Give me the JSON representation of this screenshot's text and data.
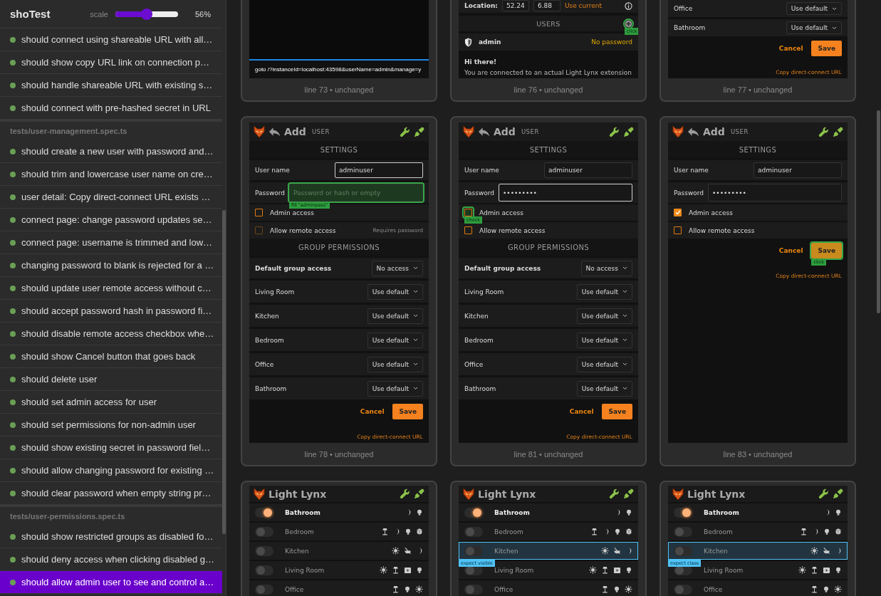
{
  "sidebar": {
    "title": "shoTest",
    "scale": {
      "label": "scale",
      "level": 0.5,
      "reading": "56%"
    },
    "items": [
      {
        "kind": "test",
        "label": "should connect using shareable URL with all…",
        "selected": false
      },
      {
        "kind": "test",
        "label": "should show copy URL link on connection p…",
        "selected": false
      },
      {
        "kind": "test",
        "label": "should handle shareable URL with existing s…",
        "selected": false
      },
      {
        "kind": "test",
        "label": "should connect with pre-hashed secret in URL",
        "selected": false
      },
      {
        "kind": "file",
        "label": "tests/user-management.spec.ts"
      },
      {
        "kind": "test",
        "label": "should create a new user with password and…",
        "selected": false
      },
      {
        "kind": "test",
        "label": "should trim and lowercase user name on cre…",
        "selected": false
      },
      {
        "kind": "test",
        "label": "user detail: Copy direct-connect URL exists …",
        "selected": false
      },
      {
        "kind": "test",
        "label": "connect page: change password updates se…",
        "selected": false
      },
      {
        "kind": "test",
        "label": "connect page: username is trimmed and low…",
        "selected": false
      },
      {
        "kind": "test",
        "label": "changing password to blank is rejected for a …",
        "selected": false
      },
      {
        "kind": "test",
        "label": "should update user remote access without c…",
        "selected": false
      },
      {
        "kind": "test",
        "label": "should accept password hash in password fi…",
        "selected": false
      },
      {
        "kind": "test",
        "label": "should disable remote access checkbox whe…",
        "selected": false
      },
      {
        "kind": "test",
        "label": "should show Cancel button that goes back",
        "selected": false
      },
      {
        "kind": "test",
        "label": "should delete user",
        "selected": false
      },
      {
        "kind": "test",
        "label": "should set admin access for user",
        "selected": false
      },
      {
        "kind": "test",
        "label": "should set permissions for non-admin user",
        "selected": false
      },
      {
        "kind": "test",
        "label": "should show existing secret in password fiel…",
        "selected": false
      },
      {
        "kind": "test",
        "label": "should allow changing password for existing …",
        "selected": false
      },
      {
        "kind": "test",
        "label": "should clear password when empty string pr…",
        "selected": false
      },
      {
        "kind": "file",
        "label": "tests/user-permissions.spec.ts"
      },
      {
        "kind": "test",
        "label": "should show restricted groups as disabled fo…",
        "selected": false
      },
      {
        "kind": "test",
        "label": "should deny access when clicking disabled g…",
        "selected": false
      },
      {
        "kind": "test",
        "label": "should allow admin user to see and control a…",
        "selected": true
      }
    ]
  },
  "card_rows": [
    [
      {
        "caption": "line 73 • unchanged",
        "screen": {
          "kind": "goto",
          "text": "goto /?instanceId=localhost:43598&userName=admin&manage=y"
        }
      },
      {
        "caption": "line 76 • unchanged",
        "screen": {
          "kind": "users",
          "location": {
            "label": "Location:",
            "latitude": "52.24",
            "longitude": "6.88",
            "link": "Use current"
          },
          "users_heading": "USERS",
          "add_annotation": {
            "kind": "action",
            "text": "click"
          },
          "users": [
            {
              "name": "admin",
              "note": "No password"
            }
          ],
          "greeting": "Hi there!",
          "message": "You are connected to an actual Light Lynx extension"
        }
      },
      {
        "caption": "line 77 • unchanged",
        "screen": {
          "kind": "user_form",
          "groups": [
            {
              "kind": "group",
              "label": "Office",
              "value": "Use default"
            },
            {
              "kind": "group",
              "label": "Bathroom",
              "value": "Use default"
            }
          ],
          "actions": {
            "cancel": "Cancel",
            "save": "Save",
            "link": "Copy direct-connect URL"
          }
        }
      }
    ],
    [
      {
        "caption": "line 78 • unchanged",
        "screen": {
          "kind": "user_form",
          "header": {
            "back": true,
            "title": "Add",
            "subtitle": "USER"
          },
          "settings_heading": "SETTINGS",
          "fields": [
            {
              "kind": "text",
              "label": "User name",
              "value": "adminuser",
              "focused": true
            },
            {
              "kind": "password",
              "label": "Password",
              "placeholder": "Password or hash or empty",
              "focused": false,
              "annotation": {
                "kind": "action",
                "text": "fill \"adminpass\""
              }
            }
          ],
          "checkboxes": [
            {
              "label": "Admin access",
              "checked": false,
              "disabled": false
            },
            {
              "label": "Allow remote access",
              "checked": false,
              "disabled": true,
              "note": "Requires password"
            }
          ],
          "groups_heading": "GROUP PERMISSIONS",
          "groups": [
            {
              "kind": "default",
              "label": "Default group access",
              "value": "No access"
            },
            {
              "kind": "group",
              "label": "Living Room",
              "value": "Use default"
            },
            {
              "kind": "group",
              "label": "Kitchen",
              "value": "Use default"
            },
            {
              "kind": "group",
              "label": "Bedroom",
              "value": "Use default"
            },
            {
              "kind": "group",
              "label": "Office",
              "value": "Use default"
            },
            {
              "kind": "group",
              "label": "Bathroom",
              "value": "Use default"
            }
          ],
          "actions": {
            "cancel": "Cancel",
            "save": "Save",
            "link": "Copy direct-connect URL"
          }
        }
      },
      {
        "caption": "line 81 • unchanged",
        "screen": {
          "kind": "user_form",
          "header": {
            "back": true,
            "title": "Add",
            "subtitle": "USER"
          },
          "settings_heading": "SETTINGS",
          "fields": [
            {
              "kind": "text",
              "label": "User name",
              "value": "adminuser",
              "focused": false
            },
            {
              "kind": "password",
              "label": "Password",
              "value": "•••••••••",
              "focused": true
            }
          ],
          "checkboxes": [
            {
              "label": "Admin access",
              "checked": false,
              "disabled": false,
              "annotation": {
                "kind": "action",
                "text": "check"
              }
            },
            {
              "label": "Allow remote access",
              "checked": false,
              "disabled": false
            }
          ],
          "groups_heading": "GROUP PERMISSIONS",
          "groups": [
            {
              "kind": "default",
              "label": "Default group access",
              "value": "No access"
            },
            {
              "kind": "group",
              "label": "Living Room",
              "value": "Use default"
            },
            {
              "kind": "group",
              "label": "Kitchen",
              "value": "Use default"
            },
            {
              "kind": "group",
              "label": "Bedroom",
              "value": "Use default"
            },
            {
              "kind": "group",
              "label": "Office",
              "value": "Use default"
            },
            {
              "kind": "group",
              "label": "Bathroom",
              "value": "Use default"
            }
          ],
          "actions": {
            "cancel": "Cancel",
            "save": "Save",
            "link": "Copy direct-connect URL"
          }
        }
      },
      {
        "caption": "line 83 • unchanged",
        "screen": {
          "kind": "user_form",
          "header": {
            "back": true,
            "title": "Add",
            "subtitle": "USER"
          },
          "settings_heading": "SETTINGS",
          "fields": [
            {
              "kind": "text",
              "label": "User name",
              "value": "adminuser",
              "focused": false
            },
            {
              "kind": "password",
              "label": "Password",
              "value": "•••••••••",
              "focused": false
            }
          ],
          "checkboxes": [
            {
              "label": "Admin access",
              "checked": true,
              "disabled": false
            },
            {
              "label": "Allow remote access",
              "checked": false,
              "disabled": false
            }
          ],
          "actions": {
            "cancel": "Cancel",
            "save": "Save",
            "link": "Copy direct-connect URL",
            "save_annotation": {
              "kind": "action",
              "text": "click"
            }
          }
        }
      }
    ],
    [
      {
        "screen": {
          "kind": "lights",
          "header": {
            "back": false,
            "title": "Light Lynx"
          },
          "rooms": [
            {
              "name": "Bathroom",
              "on": true,
              "highlighted": false,
              "scenes": [
                {
                  "kind": "moon"
                },
                {
                  "kind": "bulb"
                }
              ]
            },
            {
              "name": "Bedroom",
              "on": false,
              "highlighted": false,
              "scenes": [
                {
                  "kind": "lamp"
                },
                {
                  "kind": "moon"
                },
                {
                  "kind": "bulb"
                },
                {
                  "kind": "box"
                }
              ]
            },
            {
              "name": "Kitchen",
              "on": false,
              "highlighted": false,
              "scenes": [
                {
                  "kind": "sun"
                },
                {
                  "kind": "crossed"
                },
                {
                  "kind": "moon"
                }
              ]
            },
            {
              "name": "Living Room",
              "on": false,
              "highlighted": false,
              "scenes": [
                {
                  "kind": "sun"
                },
                {
                  "kind": "lamp"
                },
                {
                  "kind": "play"
                },
                {
                  "kind": "bulb"
                }
              ]
            },
            {
              "name": "Office",
              "on": false,
              "highlighted": false,
              "scenes": [
                {
                  "kind": "lamp"
                },
                {
                  "kind": "bulb"
                },
                {
                  "kind": "sun"
                }
              ]
            }
          ]
        }
      },
      {
        "screen": {
          "kind": "lights",
          "header": {
            "back": false,
            "title": "Light Lynx"
          },
          "rooms": [
            {
              "name": "Bathroom",
              "on": true,
              "highlighted": false,
              "scenes": [
                {
                  "kind": "moon"
                },
                {
                  "kind": "bulb"
                }
              ]
            },
            {
              "name": "Bedroom",
              "on": false,
              "highlighted": false,
              "scenes": [
                {
                  "kind": "lamp"
                },
                {
                  "kind": "moon"
                },
                {
                  "kind": "bulb"
                },
                {
                  "kind": "box"
                }
              ]
            },
            {
              "name": "Kitchen",
              "on": false,
              "highlighted": true,
              "annotation": {
                "kind": "expect",
                "text": "expect visible"
              },
              "scenes": [
                {
                  "kind": "sun"
                },
                {
                  "kind": "crossed"
                },
                {
                  "kind": "moon"
                }
              ]
            },
            {
              "name": "Living Room",
              "on": false,
              "highlighted": false,
              "scenes": [
                {
                  "kind": "sun"
                },
                {
                  "kind": "lamp"
                },
                {
                  "kind": "play"
                },
                {
                  "kind": "bulb"
                }
              ]
            },
            {
              "name": "Office",
              "on": false,
              "highlighted": false,
              "scenes": [
                {
                  "kind": "lamp"
                },
                {
                  "kind": "bulb"
                },
                {
                  "kind": "sun"
                }
              ]
            }
          ]
        }
      },
      {
        "screen": {
          "kind": "lights",
          "header": {
            "back": false,
            "title": "Light Lynx"
          },
          "rooms": [
            {
              "name": "Bathroom",
              "on": true,
              "highlighted": false,
              "scenes": [
                {
                  "kind": "moon"
                },
                {
                  "kind": "bulb"
                }
              ]
            },
            {
              "name": "Bedroom",
              "on": false,
              "highlighted": false,
              "scenes": [
                {
                  "kind": "lamp"
                },
                {
                  "kind": "moon"
                },
                {
                  "kind": "bulb"
                },
                {
                  "kind": "box"
                }
              ]
            },
            {
              "name": "Kitchen",
              "on": false,
              "highlighted": true,
              "annotation": {
                "kind": "expect",
                "text": "expect class"
              },
              "scenes": [
                {
                  "kind": "sun"
                },
                {
                  "kind": "crossed"
                },
                {
                  "kind": "moon"
                }
              ]
            },
            {
              "name": "Living Room",
              "on": false,
              "highlighted": false,
              "scenes": [
                {
                  "kind": "sun"
                },
                {
                  "kind": "lamp"
                },
                {
                  "kind": "play"
                },
                {
                  "kind": "bulb"
                }
              ]
            },
            {
              "name": "Office",
              "on": false,
              "highlighted": false,
              "scenes": [
                {
                  "kind": "lamp"
                },
                {
                  "kind": "bulb"
                },
                {
                  "kind": "sun"
                }
              ]
            }
          ]
        }
      }
    ]
  ]
}
